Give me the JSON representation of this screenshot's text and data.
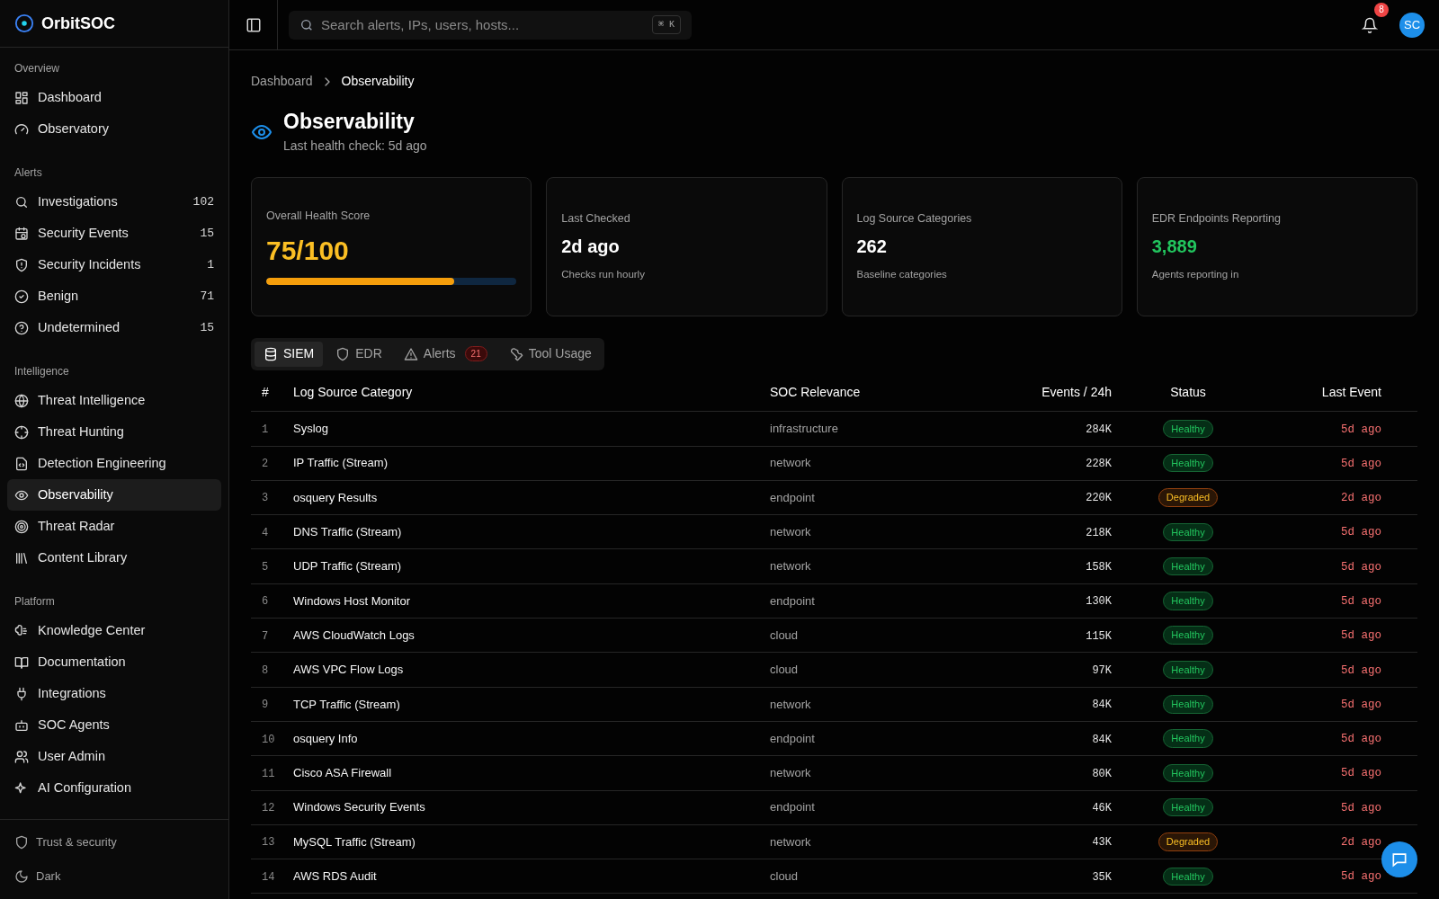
{
  "brand": {
    "name": "OrbitSOC"
  },
  "sidebar": {
    "sections": [
      {
        "title": "Overview",
        "items": [
          {
            "label": "Dashboard",
            "selected": false
          },
          {
            "label": "Observatory",
            "selected": false
          }
        ]
      },
      {
        "title": "Alerts",
        "items": [
          {
            "label": "Investigations",
            "count": "102",
            "selected": false
          },
          {
            "label": "Security Events",
            "count": "15",
            "selected": false
          },
          {
            "label": "Security Incidents",
            "count": "1",
            "selected": false
          },
          {
            "label": "Benign",
            "count": "71",
            "selected": false
          },
          {
            "label": "Undetermined",
            "count": "15",
            "selected": false
          }
        ]
      },
      {
        "title": "Intelligence",
        "items": [
          {
            "label": "Threat Intelligence",
            "selected": false
          },
          {
            "label": "Threat Hunting",
            "selected": false
          },
          {
            "label": "Detection Engineering",
            "selected": false
          },
          {
            "label": "Observability",
            "selected": true
          },
          {
            "label": "Threat Radar",
            "selected": false
          },
          {
            "label": "Content Library",
            "selected": false
          }
        ]
      },
      {
        "title": "Platform",
        "items": [
          {
            "label": "Knowledge Center",
            "selected": false
          },
          {
            "label": "Documentation",
            "selected": false
          },
          {
            "label": "Integrations",
            "selected": false
          },
          {
            "label": "SOC Agents",
            "selected": false
          },
          {
            "label": "User Admin",
            "selected": false
          },
          {
            "label": "AI Configuration",
            "selected": false
          }
        ]
      }
    ],
    "footer": [
      {
        "label": "Trust & security"
      },
      {
        "label": "Dark"
      }
    ]
  },
  "header": {
    "search": {
      "placeholder": "Search alerts, IPs, users, hosts...",
      "shortcut": "⌘ K"
    },
    "notifications": "8",
    "avatar": "SC"
  },
  "breadcrumb": [
    "Dashboard",
    "Observability"
  ],
  "page": {
    "title": "Observability",
    "subtitle": "Last health check: 5d ago"
  },
  "cards": [
    {
      "kind": "score",
      "label": "Overall Health Score",
      "value": "75/100",
      "level": 0.75
    },
    {
      "kind": "plain",
      "label": "Last Checked",
      "value": "2d ago",
      "note": "Checks run hourly"
    },
    {
      "kind": "plain",
      "label": "Log Source Categories",
      "value": "262",
      "note": "Baseline categories"
    },
    {
      "kind": "good",
      "label": "EDR Endpoints Reporting",
      "value": "3,889",
      "note": "Agents reporting in"
    }
  ],
  "tabs": [
    {
      "label": "SIEM",
      "selected": true
    },
    {
      "label": "EDR",
      "selected": false
    },
    {
      "label": "Alerts",
      "badge": "21",
      "selected": false
    },
    {
      "label": "Tool Usage",
      "selected": false
    }
  ],
  "table": {
    "columns": [
      "#",
      "Log Source Category",
      "SOC Relevance",
      "Events / 24h",
      "Status",
      "Last Event"
    ],
    "rows": [
      {
        "num": "1",
        "category": "Syslog",
        "relevance": "infrastructure",
        "events": "284K",
        "status": "Healthy",
        "kind": "healthy",
        "last": "5d ago"
      },
      {
        "num": "2",
        "category": "IP Traffic (Stream)",
        "relevance": "network",
        "events": "228K",
        "status": "Healthy",
        "kind": "healthy",
        "last": "5d ago"
      },
      {
        "num": "3",
        "category": "osquery Results",
        "relevance": "endpoint",
        "events": "220K",
        "status": "Degraded",
        "kind": "degraded",
        "last": "2d ago"
      },
      {
        "num": "4",
        "category": "DNS Traffic (Stream)",
        "relevance": "network",
        "events": "218K",
        "status": "Healthy",
        "kind": "healthy",
        "last": "5d ago"
      },
      {
        "num": "5",
        "category": "UDP Traffic (Stream)",
        "relevance": "network",
        "events": "158K",
        "status": "Healthy",
        "kind": "healthy",
        "last": "5d ago"
      },
      {
        "num": "6",
        "category": "Windows Host Monitor",
        "relevance": "endpoint",
        "events": "130K",
        "status": "Healthy",
        "kind": "healthy",
        "last": "5d ago"
      },
      {
        "num": "7",
        "category": "AWS CloudWatch Logs",
        "relevance": "cloud",
        "events": "115K",
        "status": "Healthy",
        "kind": "healthy",
        "last": "5d ago"
      },
      {
        "num": "8",
        "category": "AWS VPC Flow Logs",
        "relevance": "cloud",
        "events": "97K",
        "status": "Healthy",
        "kind": "healthy",
        "last": "5d ago"
      },
      {
        "num": "9",
        "category": "TCP Traffic (Stream)",
        "relevance": "network",
        "events": "84K",
        "status": "Healthy",
        "kind": "healthy",
        "last": "5d ago"
      },
      {
        "num": "10",
        "category": "osquery Info",
        "relevance": "endpoint",
        "events": "84K",
        "status": "Healthy",
        "kind": "healthy",
        "last": "5d ago"
      },
      {
        "num": "11",
        "category": "Cisco ASA Firewall",
        "relevance": "network",
        "events": "80K",
        "status": "Healthy",
        "kind": "healthy",
        "last": "5d ago"
      },
      {
        "num": "12",
        "category": "Windows Security Events",
        "relevance": "endpoint",
        "events": "46K",
        "status": "Healthy",
        "kind": "healthy",
        "last": "5d ago"
      },
      {
        "num": "13",
        "category": "MySQL Traffic (Stream)",
        "relevance": "network",
        "events": "43K",
        "status": "Degraded",
        "kind": "degraded",
        "last": "2d ago"
      },
      {
        "num": "14",
        "category": "AWS RDS Audit",
        "relevance": "cloud",
        "events": "35K",
        "status": "Healthy",
        "kind": "healthy",
        "last": "5d ago"
      }
    ]
  }
}
